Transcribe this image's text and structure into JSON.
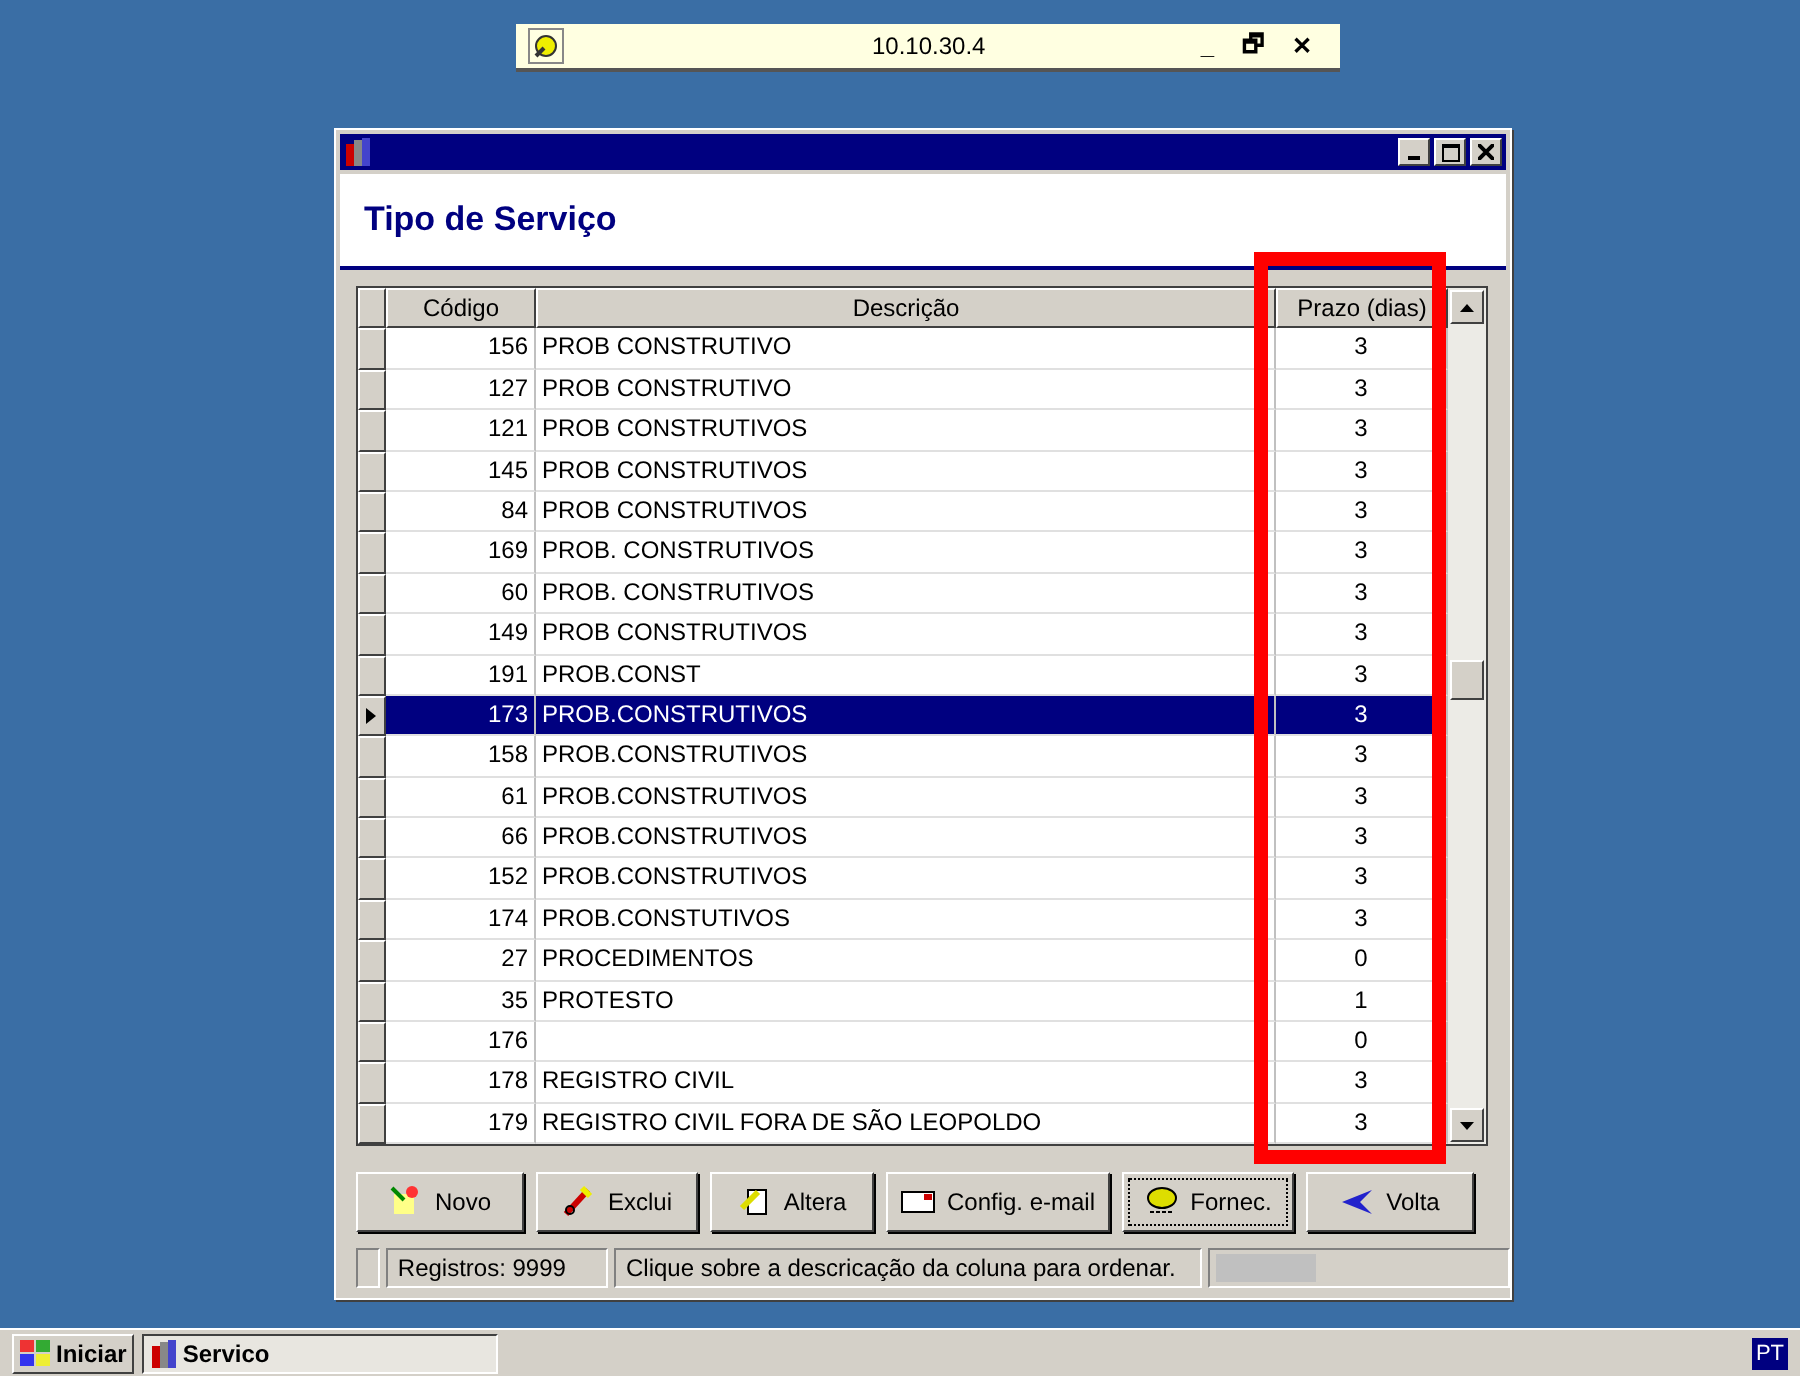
{
  "remote_bar": {
    "title": "10.10.30.4",
    "controls": [
      "_",
      "🗗",
      "✕"
    ]
  },
  "window": {
    "heading": "Tipo de Serviço"
  },
  "table": {
    "columns": [
      "Código",
      "Descrição",
      "Prazo (dias)"
    ],
    "rows": [
      {
        "cells": [
          "156",
          "PROB CONSTRUTIVO",
          "3"
        ],
        "selected": false
      },
      {
        "cells": [
          "127",
          "PROB CONSTRUTIVO",
          "3"
        ],
        "selected": false
      },
      {
        "cells": [
          "121",
          "PROB CONSTRUTIVOS",
          "3"
        ],
        "selected": false
      },
      {
        "cells": [
          "145",
          "PROB CONSTRUTIVOS",
          "3"
        ],
        "selected": false
      },
      {
        "cells": [
          "84",
          "PROB CONSTRUTIVOS",
          "3"
        ],
        "selected": false
      },
      {
        "cells": [
          "169",
          "PROB. CONSTRUTIVOS",
          "3"
        ],
        "selected": false
      },
      {
        "cells": [
          "60",
          "PROB. CONSTRUTIVOS",
          "3"
        ],
        "selected": false
      },
      {
        "cells": [
          "149",
          "PROB CONSTRUTIVOS",
          "3"
        ],
        "selected": false
      },
      {
        "cells": [
          "191",
          "PROB.CONST",
          "3"
        ],
        "selected": false
      },
      {
        "cells": [
          "173",
          "PROB.CONSTRUTIVOS",
          "3"
        ],
        "selected": true
      },
      {
        "cells": [
          "158",
          "PROB.CONSTRUTIVOS",
          "3"
        ],
        "selected": false
      },
      {
        "cells": [
          "61",
          "PROB.CONSTRUTIVOS",
          "3"
        ],
        "selected": false
      },
      {
        "cells": [
          "66",
          "PROB.CONSTRUTIVOS",
          "3"
        ],
        "selected": false
      },
      {
        "cells": [
          "152",
          "PROB.CONSTRUTIVOS",
          "3"
        ],
        "selected": false
      },
      {
        "cells": [
          "174",
          "PROB.CONSTUTIVOS",
          "3"
        ],
        "selected": false
      },
      {
        "cells": [
          "27",
          "PROCEDIMENTOS",
          "0"
        ],
        "selected": false
      },
      {
        "cells": [
          "35",
          "PROTESTO",
          "1"
        ],
        "selected": false
      },
      {
        "cells": [
          "176",
          "",
          "0"
        ],
        "selected": false
      },
      {
        "cells": [
          "178",
          "REGISTRO CIVIL",
          "3"
        ],
        "selected": false
      },
      {
        "cells": [
          "179",
          "REGISTRO CIVIL FORA DE SÃO LEOPOLDO",
          "3"
        ],
        "selected": false
      }
    ]
  },
  "buttons": [
    {
      "label": "Novo",
      "kind": "new"
    },
    {
      "label": "Exclui",
      "kind": "delete"
    },
    {
      "label": "Altera",
      "kind": "edit"
    },
    {
      "label": "Config. e-mail",
      "kind": "mail"
    },
    {
      "label": "Fornec.",
      "kind": "supplier"
    },
    {
      "label": "Volta",
      "kind": "back"
    }
  ],
  "status_bar": [
    "Registros: 9999",
    "Clique sobre a descricação da coluna para ordenar."
  ],
  "taskbar": {
    "start": "Iniciar",
    "tasks": [
      "Servico"
    ],
    "language": "PT"
  }
}
